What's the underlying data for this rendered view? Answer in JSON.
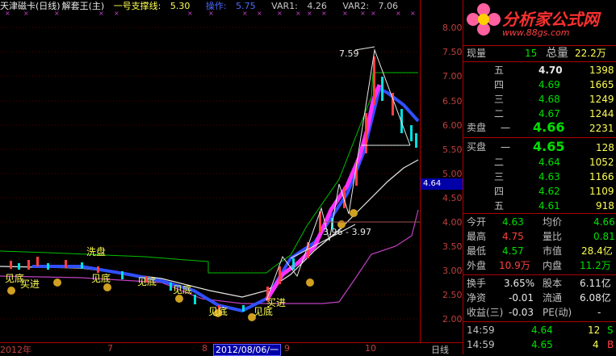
{
  "header": {
    "title": "天津磁卡(日线)",
    "indicator": "解套王(主)",
    "support_label": "一号支撑线:",
    "support_value": "5.30",
    "op_label": "操作:",
    "op_value": "5.75",
    "var1_label": "VAR1:",
    "var1_value": "4.26",
    "var2_label": "VAR2:",
    "var2_value": "7.06"
  },
  "chart_labels": {
    "high_price": "7.59",
    "range_label": "3.96 - 3.97",
    "wash": "洗盘",
    "bottoms": [
      "见底",
      "见底",
      "见底",
      "见底",
      "见底",
      "见底"
    ],
    "enter": [
      "买进",
      "买进"
    ],
    "current_price_tag": "4.64"
  },
  "yaxis": {
    "ticks": [
      "8.00",
      "7.50",
      "7.00",
      "6.50",
      "6.00",
      "5.50",
      "5.00",
      "4.50",
      "4.00",
      "3.50",
      "3.00",
      "2.50",
      "2.00"
    ]
  },
  "xaxis": {
    "labels": [
      "2012年",
      "7",
      "8",
      "9",
      "10"
    ],
    "selected": "2012/08/06/一",
    "period": "日线"
  },
  "logo": {
    "text": "分析家公式网",
    "url": "www.88gs.com"
  },
  "quote": {
    "now_label": "现量",
    "now_value": "15",
    "total_label": "总量",
    "total_value": "22.2万",
    "sell_side_label": "卖盘",
    "buy_side_label": "买盘",
    "sells": [
      {
        "level": "五",
        "price": "4.70",
        "vol": "1398"
      },
      {
        "level": "四",
        "price": "4.69",
        "vol": "1665"
      },
      {
        "level": "三",
        "price": "4.68",
        "vol": "1249"
      },
      {
        "level": "二",
        "price": "4.67",
        "vol": "1244"
      },
      {
        "level": "一",
        "price": "4.66",
        "vol": "2231"
      }
    ],
    "buys": [
      {
        "level": "一",
        "price": "4.65",
        "vol": "128"
      },
      {
        "level": "二",
        "price": "4.64",
        "vol": "1052"
      },
      {
        "level": "三",
        "price": "4.63",
        "vol": "1166"
      },
      {
        "level": "四",
        "price": "4.62",
        "vol": "1109"
      },
      {
        "level": "五",
        "price": "4.61",
        "vol": "918"
      }
    ],
    "stats": [
      {
        "l1": "今开",
        "v1": "4.63",
        "l2": "均价",
        "v2": "4.66"
      },
      {
        "l1": "最高",
        "v1": "4.75",
        "l2": "量比",
        "v2": "0.81"
      },
      {
        "l1": "最低",
        "v1": "4.57",
        "l2": "市值",
        "v2": "28.4亿"
      },
      {
        "l1": "外盘",
        "v1": "10.9万",
        "l2": "内盘",
        "v2": "11.2万"
      }
    ],
    "stats2": [
      {
        "l1": "换手",
        "v1": "3.65%",
        "l2": "股本",
        "v2": "6.11亿"
      },
      {
        "l1": "净资",
        "v1": "-0.01",
        "l2": "流通",
        "v2": "6.08亿"
      },
      {
        "l1": "收益(三)",
        "v1": "-0.03",
        "l2": "PE(动)",
        "v2": "-"
      }
    ],
    "ticks": [
      {
        "time": "14:59",
        "price": "4.64",
        "vol": "12",
        "side": "S"
      },
      {
        "time": "14:59",
        "price": "4.65",
        "vol": "4",
        "side": "B"
      }
    ]
  },
  "colors": {
    "up": "#ff4040",
    "down": "#00e000",
    "axis": "#b00000"
  }
}
